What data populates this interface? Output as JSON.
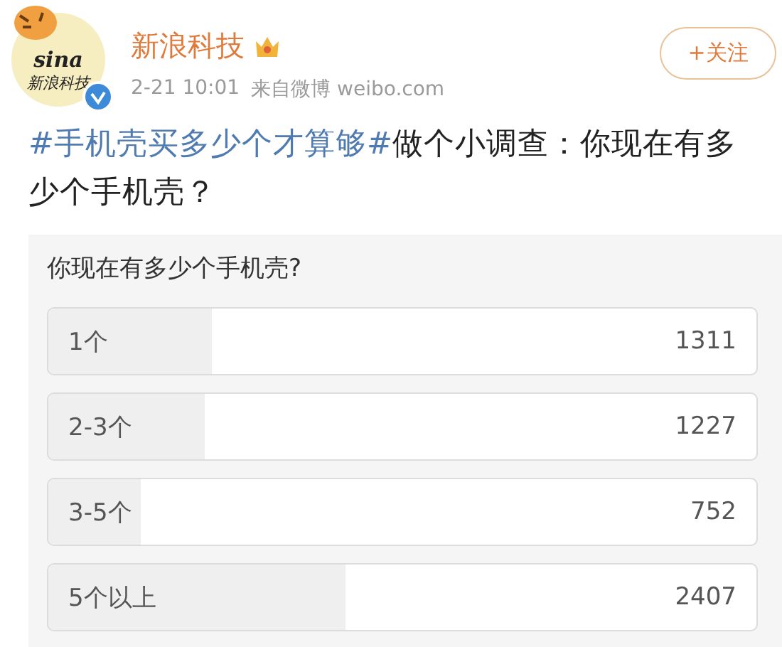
{
  "author": {
    "name": "新浪科技",
    "avatar_logo": "sina",
    "avatar_caption": "新浪科技",
    "verified": true
  },
  "follow_button": {
    "label": "+关注"
  },
  "meta": {
    "time": "2-21 10:01",
    "source": "来自微博 weibo.com"
  },
  "post": {
    "hashtag": "#手机壳买多少个才算够#",
    "text": "做个小调查：你现在有多少个手机壳？"
  },
  "poll": {
    "question": "你现在有多少个手机壳?",
    "options": [
      {
        "label": "1个",
        "count": "1311",
        "level": 0.23
      },
      {
        "label": "2-3个",
        "count": "1227",
        "level": 0.22
      },
      {
        "label": "3-5个",
        "count": "752",
        "level": 0.13
      },
      {
        "label": "5个以上",
        "count": "2407",
        "level": 0.42
      }
    ]
  }
}
